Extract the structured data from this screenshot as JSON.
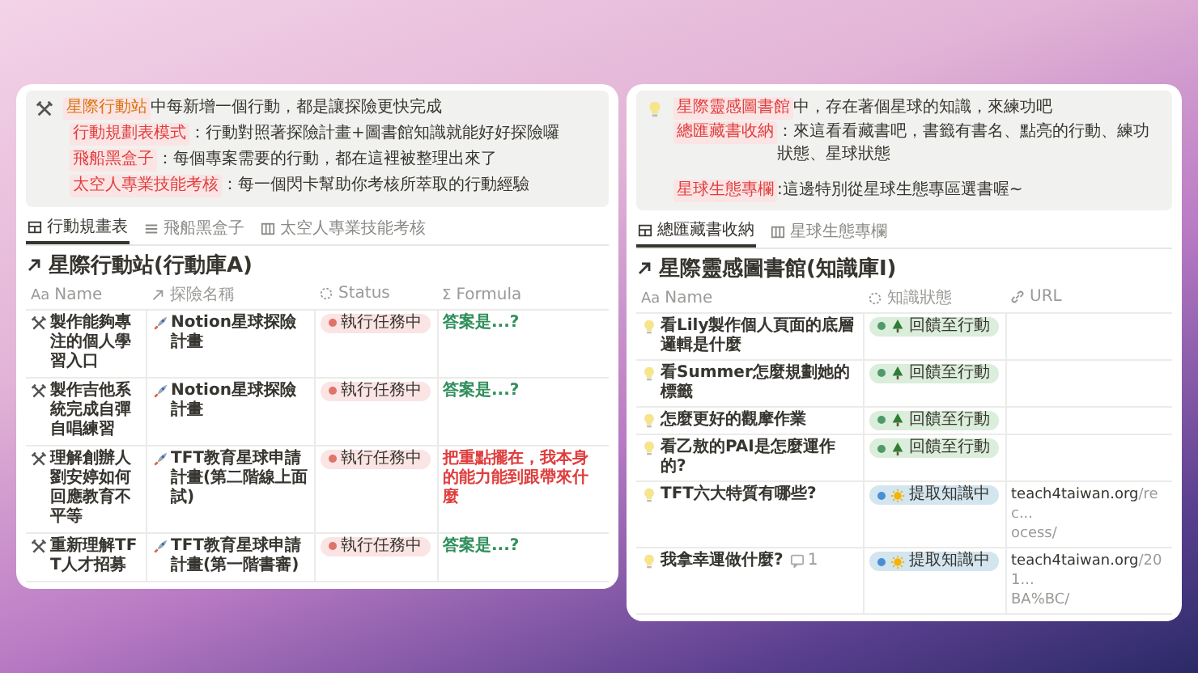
{
  "left_panel": {
    "callout": {
      "lines": [
        {
          "label": "星際行動站",
          "color": "#d9730d",
          "text": "中每新增一個行動，都是讓探險更快完成"
        },
        {
          "label": "行動規劃表模式",
          "color": "#e03e3e",
          "text": "：行動對照著探險計畫+圖書館知識就能好好探險囉"
        },
        {
          "label": "飛船黑盒子",
          "color": "#e03e3e",
          "text": "：每個專案需要的行動，都在這裡被整理出來了"
        },
        {
          "label": "太空人專業技能考核",
          "color": "#e03e3e",
          "text": "：每一個閃卡幫助你考核所萃取的行動經驗"
        }
      ]
    },
    "tabs": [
      {
        "label": "行動規畫表",
        "kind": "table",
        "selected": true
      },
      {
        "label": "飛船黑盒子",
        "kind": "list",
        "selected": false
      },
      {
        "label": "太空人專業技能考核",
        "kind": "board",
        "selected": false
      }
    ],
    "title": "星際行動站(行動庫A)",
    "columns": [
      {
        "icon_text": "Aa",
        "label": "Name",
        "kind": "text"
      },
      {
        "label": "探險名稱",
        "kind": "relation"
      },
      {
        "label": "Status",
        "kind": "status"
      },
      {
        "icon_text": "Σ",
        "label": "Formula",
        "kind": "formula"
      }
    ],
    "rows": [
      {
        "name": "製作能夠專注的個人學習入口",
        "project": "Notion星球探險計畫",
        "status": {
          "text": "執行任務中",
          "color": "#e0736a"
        },
        "formula": {
          "text": "答案是...?",
          "color": "#2f8f5b"
        }
      },
      {
        "name": "製作吉他系統完成自彈自唱練習",
        "project": "Notion星球探險計畫",
        "status": {
          "text": "執行任務中",
          "color": "#e0736a"
        },
        "formula": {
          "text": "答案是...?",
          "color": "#2f8f5b"
        }
      },
      {
        "name": "理解創辦人劉安婷如何回應教育不平等",
        "project": "TFT教育星球申請計畫(第二階線上面試)",
        "status": {
          "text": "執行任務中",
          "color": "#e0736a"
        },
        "formula": {
          "text": "把重點擺在，我本身的能力能到跟帶來什麼",
          "color": "#e03e3e"
        }
      },
      {
        "name": "重新理解TFT人才招募",
        "project": "TFT教育星球申請計畫(第一階書審)",
        "status": {
          "text": "執行任務中",
          "color": "#e0736a"
        },
        "formula": {
          "text": "答案是...?",
          "color": "#2f8f5b"
        }
      }
    ]
  },
  "right_panel": {
    "callout": {
      "lines": [
        {
          "label": "星際靈感圖書館",
          "color": "#e03e3e",
          "text": "中，存在著個星球的知識，來練功吧"
        },
        {
          "label": "總匯藏書收納",
          "color": "#e03e3e",
          "text": "：來這看看藏書吧，書籤有書名、點亮的行動、練功狀態、星球狀態"
        },
        {
          "label": "星球生態專欄",
          "color": "#e03e3e",
          "text": ":這邊特別從星球生態專區選書喔~"
        }
      ]
    },
    "tabs": [
      {
        "label": "總匯藏書收納",
        "kind": "table",
        "selected": true
      },
      {
        "label": "星球生態專欄",
        "kind": "board",
        "selected": false
      }
    ],
    "title": "星際靈感圖書館(知識庫I)",
    "columns": [
      {
        "icon_text": "Aa",
        "label": "Name",
        "kind": "text"
      },
      {
        "label": "知識狀態",
        "kind": "status"
      },
      {
        "label": "URL",
        "kind": "url"
      }
    ],
    "rows": [
      {
        "name": "看Lily製作個人頁面的底層邏輯是什麼",
        "status": {
          "text": "回饋至行動",
          "kind": "tree",
          "color": "#4f9a6a"
        }
      },
      {
        "name": "看Summer怎麼規劃她的標籤",
        "status": {
          "text": "回饋至行動",
          "kind": "tree",
          "color": "#4f9a6a"
        }
      },
      {
        "name": "怎麼更好的觀摩作業",
        "status": {
          "text": "回饋至行動",
          "kind": "tree",
          "color": "#4f9a6a"
        }
      },
      {
        "name": "看乙敖的PAI是怎麼運作的?",
        "status": {
          "text": "回饋至行動",
          "kind": "tree",
          "color": "#4f9a6a"
        }
      },
      {
        "name": "TFT六大特質有哪些?",
        "status": {
          "text": "提取知識中",
          "kind": "sun",
          "color": "#4a8fd4"
        },
        "url": {
          "host": "teach4taiwan.org",
          "path": "/rec...",
          "path_2": "ocess/"
        }
      },
      {
        "name": "我拿幸運做什麼?",
        "comments": "1",
        "status": {
          "text": "提取知識中",
          "kind": "sun",
          "color": "#4a8fd4"
        },
        "url": {
          "host": "teach4taiwan.org",
          "path": "/201...",
          "path_2": "BA%BC/"
        }
      }
    ]
  }
}
